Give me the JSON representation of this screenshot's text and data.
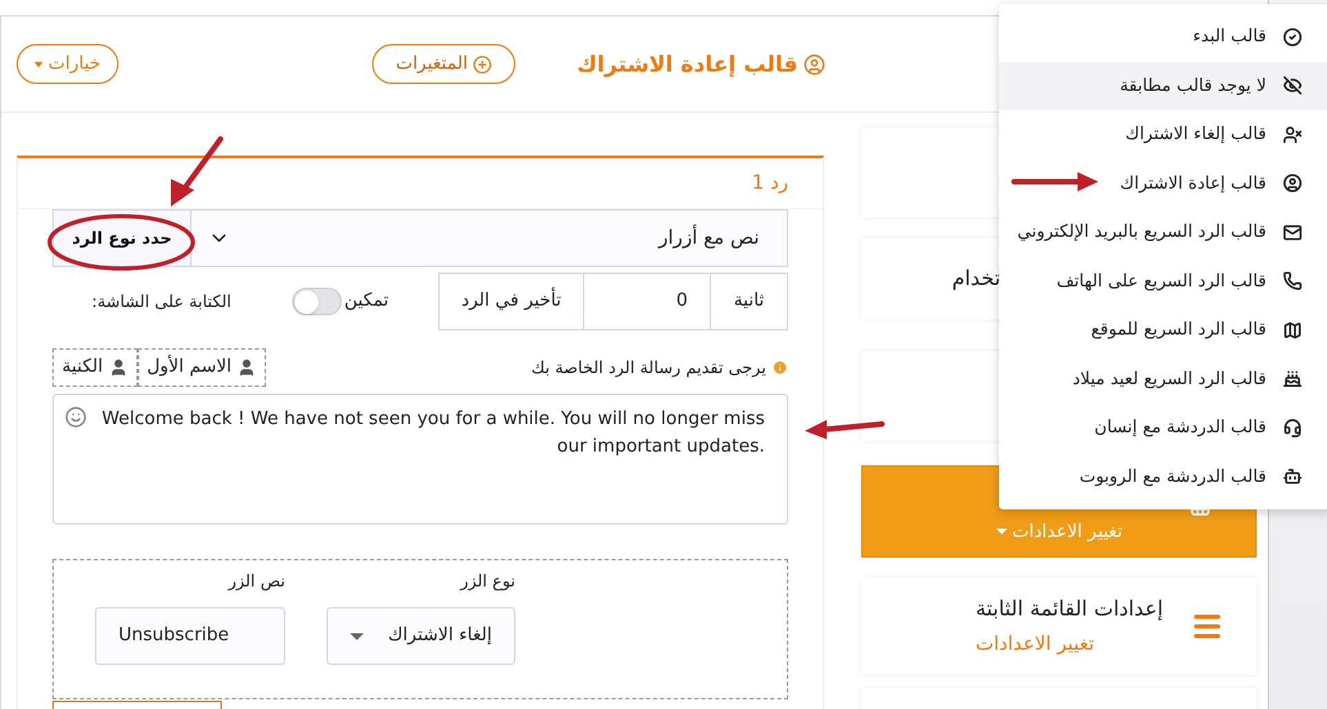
{
  "header": {
    "title": "قالب إعادة الاشتراك",
    "variables_button": "المتغيرات",
    "options_button": "خيارات"
  },
  "reply": {
    "title": "رد 1",
    "type_label": "حدد نوع الرد",
    "type_value": "نص مع أزرار",
    "delay_unit": "ثانية",
    "delay_value": "0",
    "delay_label": "تأخير في الرد",
    "enable_label": "تمكين",
    "typing_on": false,
    "typing_label": "الكتابة على الشاشة:",
    "hint": "يرجى تقديم رسالة الرد الخاصة بك",
    "chips": [
      "الاسم الأول",
      "الكنية"
    ],
    "message": "Welcome back ! We have not seen you for a while. You will no longer miss our important updates.",
    "button_type_label": "نوع الزر",
    "button_type_value": "إلغاء الاشتراك",
    "button_text_label": "نص الزر",
    "button_text_value": "Unsubscribe"
  },
  "cards": [
    {
      "kind": "plain"
    },
    {
      "kind": "plain",
      "title": "تخدام"
    },
    {
      "kind": "plain"
    },
    {
      "kind": "accent",
      "subtitle": "تغيير الاعدادات"
    },
    {
      "kind": "menu",
      "title": "إعدادات القائمة الثابتة",
      "subtitle": "تغيير الاعدادات"
    },
    {
      "kind": "plain"
    }
  ],
  "menu": [
    {
      "label": "قالب البدء",
      "selected": false
    },
    {
      "label": "لا يوجد قالب مطابقة",
      "selected": true
    },
    {
      "label": "قالب إلغاء الاشتراك",
      "selected": false
    },
    {
      "label": "قالب إعادة الاشتراك",
      "selected": false
    },
    {
      "label": "قالب الرد السريع بالبريد الإلكتروني",
      "selected": false
    },
    {
      "label": "قالب الرد السريع على الهاتف",
      "selected": false
    },
    {
      "label": "قالب الرد السريع للموقع",
      "selected": false
    },
    {
      "label": "قالب الرد السريع لعيد ميلاد",
      "selected": false
    },
    {
      "label": "قالب الدردشة مع إنسان",
      "selected": false
    },
    {
      "label": "قالب الدردشة مع الروبوت",
      "selected": false
    }
  ]
}
